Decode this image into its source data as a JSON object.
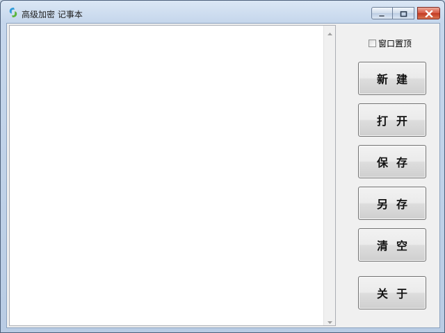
{
  "window": {
    "title": "高级加密 记事本"
  },
  "editor": {
    "content": ""
  },
  "options": {
    "topmost_label": "窗口置顶",
    "topmost_checked": false
  },
  "buttons": {
    "new_label": "新建",
    "open_label": "打开",
    "save_label": "保存",
    "save_as_label": "另存",
    "clear_label": "清空",
    "about_label": "关于"
  },
  "colors": {
    "close_button": "#c8432b",
    "client_background": "#f0f0f0",
    "editor_background": "#ffffff"
  },
  "icons": {
    "app": "app-logo-icon",
    "minimize": "minimize-icon",
    "maximize": "maximize-icon",
    "close": "close-icon",
    "scroll_up": "scroll-up-arrow-icon",
    "scroll_down": "scroll-down-arrow-icon"
  }
}
